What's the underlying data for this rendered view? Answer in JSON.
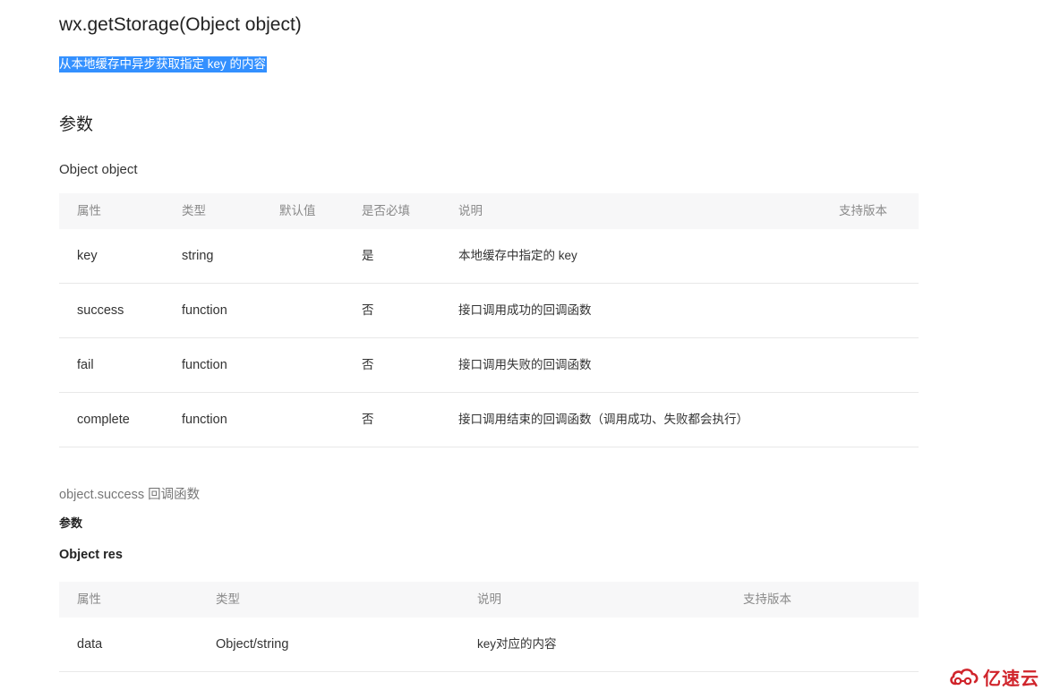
{
  "title": "wx.getStorage(Object object)",
  "description": "从本地缓存中异步获取指定 key 的内容",
  "params_heading": "参数",
  "object_label": "Object object",
  "params_table": {
    "headers": [
      "属性",
      "类型",
      "默认值",
      "是否必填",
      "说明",
      "支持版本"
    ],
    "rows": [
      {
        "attr": "key",
        "type": "string",
        "default": "",
        "required": "是",
        "desc": "本地缓存中指定的 key",
        "version": ""
      },
      {
        "attr": "success",
        "type": "function",
        "default": "",
        "required": "否",
        "desc": "接口调用成功的回调函数",
        "version": ""
      },
      {
        "attr": "fail",
        "type": "function",
        "default": "",
        "required": "否",
        "desc": "接口调用失败的回调函数",
        "version": ""
      },
      {
        "attr": "complete",
        "type": "function",
        "default": "",
        "required": "否",
        "desc": "接口调用结束的回调函数（调用成功、失败都会执行）",
        "version": ""
      }
    ]
  },
  "callback_label": "object.success 回调函数",
  "callback_params_heading": "参数",
  "res_label": "Object res",
  "res_table": {
    "headers": [
      "属性",
      "类型",
      "说明",
      "支持版本"
    ],
    "rows": [
      {
        "attr": "data",
        "type": "Object/string",
        "desc": "key对应的内容",
        "version": ""
      }
    ]
  },
  "watermark": {
    "text": "亿速云",
    "logo": "cloud-logo-icon",
    "color": "#d0242b"
  },
  "colors": {
    "selection": "#3390ff",
    "table_header_bg": "#f7f7f8",
    "divider": "#e8e8e8"
  }
}
